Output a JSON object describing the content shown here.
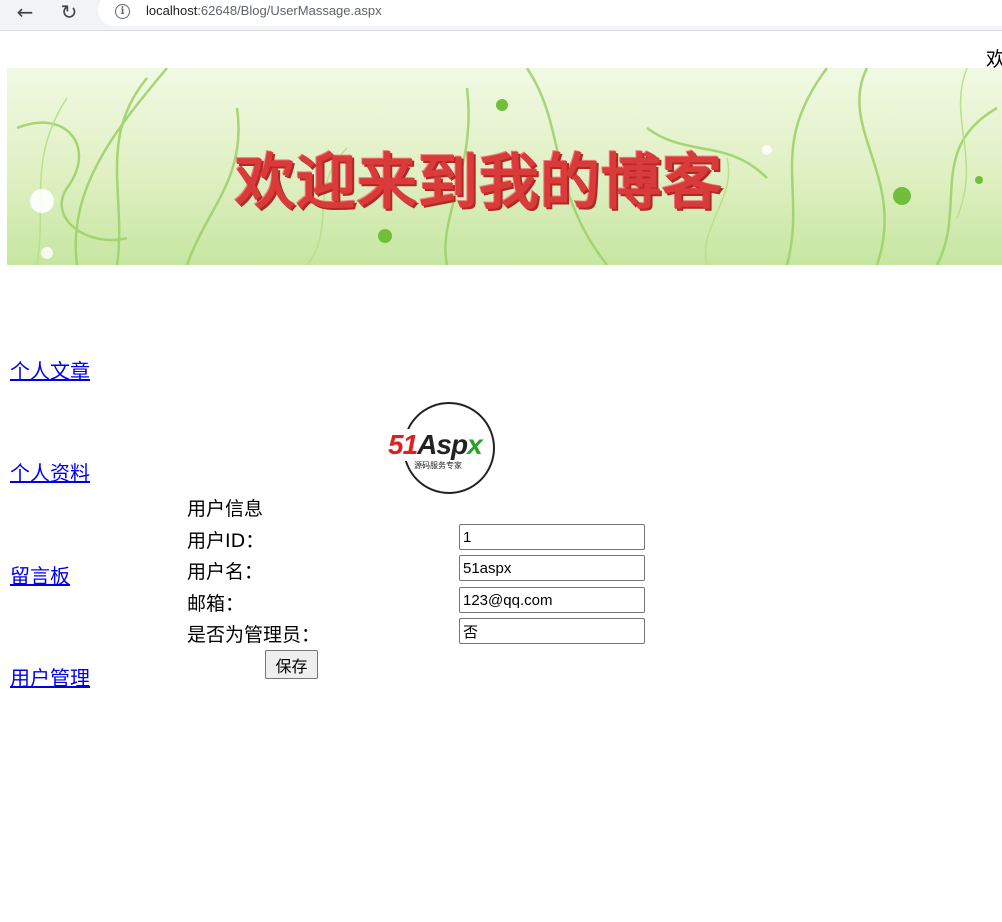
{
  "browser": {
    "url_host": "localhost",
    "url_rest": ":62648/Blog/UserMassage.aspx",
    "back_icon": "arrow-left-icon",
    "reload_icon": "reload-icon"
  },
  "page": {
    "welcome_text": "欢",
    "banner_title": "欢迎来到我的博客"
  },
  "sidebar": {
    "items": [
      {
        "label": "个人文章"
      },
      {
        "label": "个人资料"
      },
      {
        "label": "留言板"
      },
      {
        "label": "用户管理"
      }
    ]
  },
  "logo": {
    "num": "51",
    "a": "Asp",
    "x": "x",
    "sub": "源码服务专家"
  },
  "form": {
    "title": "用户信息",
    "fields": [
      {
        "label": "用户ID：",
        "value": "1"
      },
      {
        "label": "用户名：",
        "value": "51aspx"
      },
      {
        "label": "邮箱：",
        "value": "123@qq.com"
      },
      {
        "label": "是否为管理员：",
        "value": "否"
      }
    ],
    "save_label": "保存"
  },
  "colors": {
    "link": "#0000ee",
    "banner_title": "#d93a3a",
    "banner_bg": "#dff0c2"
  }
}
